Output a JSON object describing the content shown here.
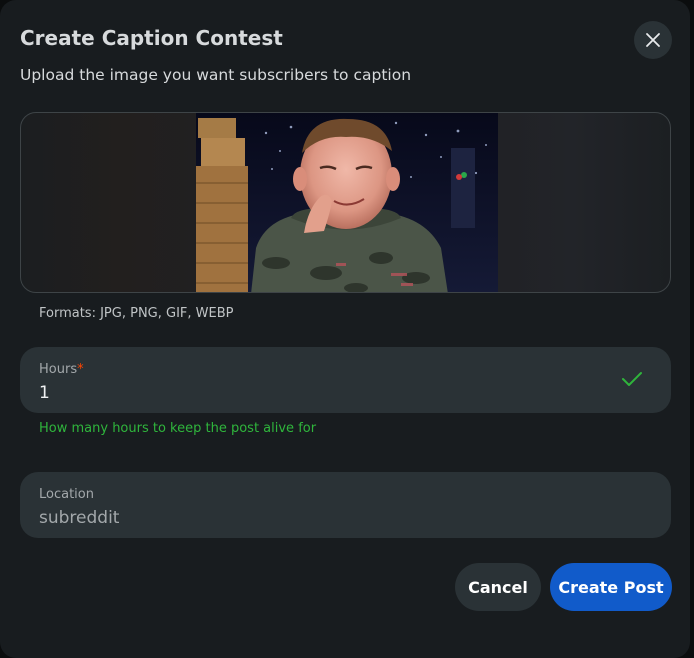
{
  "dialog": {
    "title": "Create Caption Contest",
    "subtitle": "Upload the image you want subscribers to caption"
  },
  "upload": {
    "formats_hint": "Formats: JPG, PNG, GIF, WEBP"
  },
  "hours_field": {
    "label": "Hours",
    "required_marker": "*",
    "value": "1",
    "helper": "How many hours to keep the post alive for"
  },
  "location_field": {
    "label": "Location",
    "placeholder": "subreddit"
  },
  "actions": {
    "cancel_label": "Cancel",
    "create_label": "Create Post"
  },
  "colors": {
    "dialog_bg": "#181c1f",
    "field_bg": "#2a3236",
    "primary": "#115bca",
    "success": "#2fb53c",
    "required": "#ff4500"
  },
  "icons": {
    "close": "close-icon",
    "valid": "checkmark-icon"
  }
}
